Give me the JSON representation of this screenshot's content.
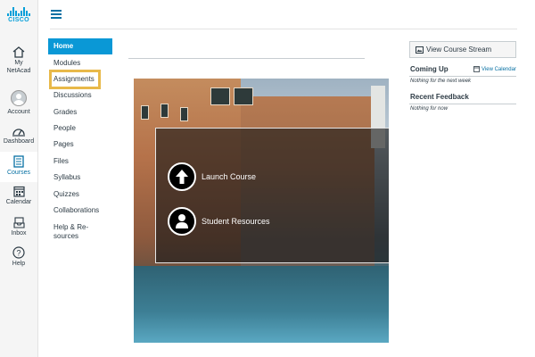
{
  "global_nav": {
    "logo_text": "CISCO",
    "items": [
      {
        "icon": "home-icon",
        "label": "My NetAcad",
        "line1": "My",
        "line2": "NetAcad"
      },
      {
        "icon": "avatar-icon",
        "label": "Account"
      },
      {
        "icon": "dashboard-icon",
        "label": "Dashboard"
      },
      {
        "icon": "courses-icon",
        "label": "Courses",
        "active": true
      },
      {
        "icon": "calendar-icon",
        "label": "Calendar"
      },
      {
        "icon": "inbox-icon",
        "label": "Inbox"
      },
      {
        "icon": "help-icon",
        "label": "Help"
      }
    ]
  },
  "course_nav": {
    "items": [
      {
        "label": "Home",
        "active": true
      },
      {
        "label": "Modules"
      },
      {
        "label": "Assignments",
        "highlighted": true
      },
      {
        "label": "Discussions"
      },
      {
        "label": "Grades"
      },
      {
        "label": "People"
      },
      {
        "label": "Pages"
      },
      {
        "label": "Files"
      },
      {
        "label": "Syllabus"
      },
      {
        "label": "Quizzes"
      },
      {
        "label": "Collaborations"
      },
      {
        "label": "Help & Re-sources",
        "line1": "Help & Re-",
        "line2": "sources"
      }
    ]
  },
  "main": {
    "buttons": [
      {
        "icon": "arrow-up-icon",
        "label": "Launch Course"
      },
      {
        "icon": "person-icon",
        "label": "Student Resources"
      }
    ]
  },
  "sidebar": {
    "view_stream_label": "View Course Stream",
    "coming_up_title": "Coming Up",
    "view_calendar_label": "View Calendar",
    "coming_up_text": "Nothing for the next week",
    "recent_feedback_title": "Recent Feedback",
    "recent_feedback_text": "Nothing for now"
  },
  "colors": {
    "accent": "#0770a3",
    "home_active": "#0a98d6",
    "highlight_box": "#e8b94a",
    "cisco_blue": "#049fd9"
  }
}
